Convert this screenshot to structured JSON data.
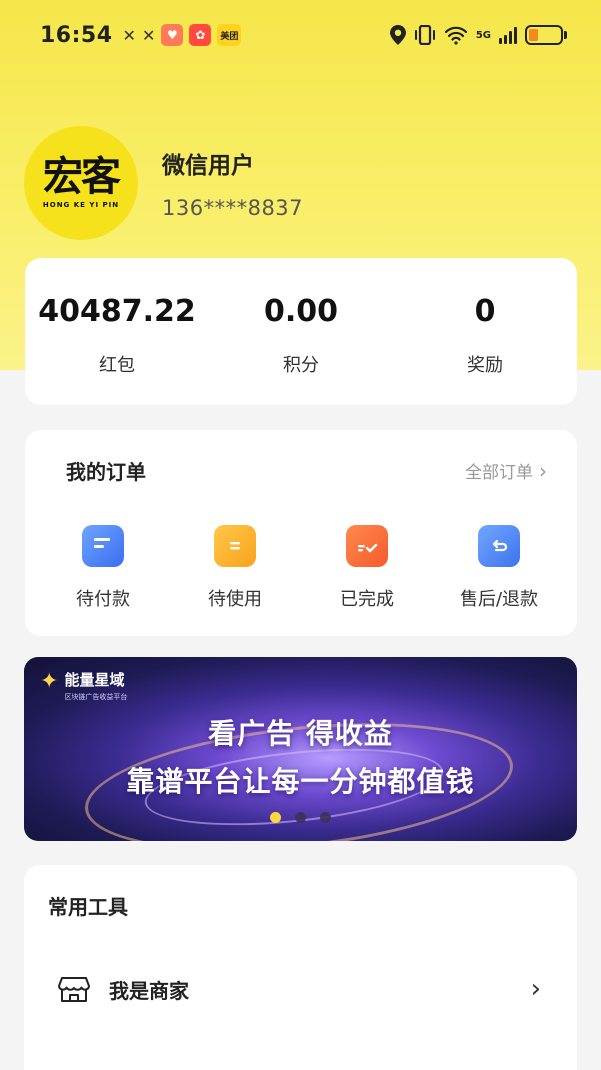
{
  "status_bar": {
    "time": "16:54",
    "meituan_badge": "美团",
    "network": "5G"
  },
  "profile": {
    "avatar_logo": "宏客",
    "avatar_sub": "HONG KE YI PIN",
    "name": "微信用户",
    "phone": "136****8837"
  },
  "stats": [
    {
      "value": "40487.22",
      "label": "红包"
    },
    {
      "value": "0.00",
      "label": "积分"
    },
    {
      "value": "0",
      "label": "奖励"
    }
  ],
  "orders": {
    "title": "我的订单",
    "all_label": "全部订单",
    "items": [
      {
        "label": "待付款",
        "icon": "wallet-icon"
      },
      {
        "label": "待使用",
        "icon": "ticket-icon"
      },
      {
        "label": "已完成",
        "icon": "check-box-icon"
      },
      {
        "label": "售后/退款",
        "icon": "refund-icon"
      }
    ]
  },
  "banner": {
    "brand_name": "能量星域",
    "brand_sub": "区块链广告收益平台",
    "line1": "看广告 得收益",
    "line2": "靠谱平台让每一分钟都值钱",
    "pages": 3,
    "active_page": 1
  },
  "tools": {
    "title": "常用工具",
    "items": [
      {
        "label": "我是商家",
        "icon": "shop-icon"
      }
    ]
  },
  "colors": {
    "header_yellow": "#f6e64a",
    "banner_active_dot": "#ffd93b",
    "battery_orange": "#f28a1e"
  }
}
